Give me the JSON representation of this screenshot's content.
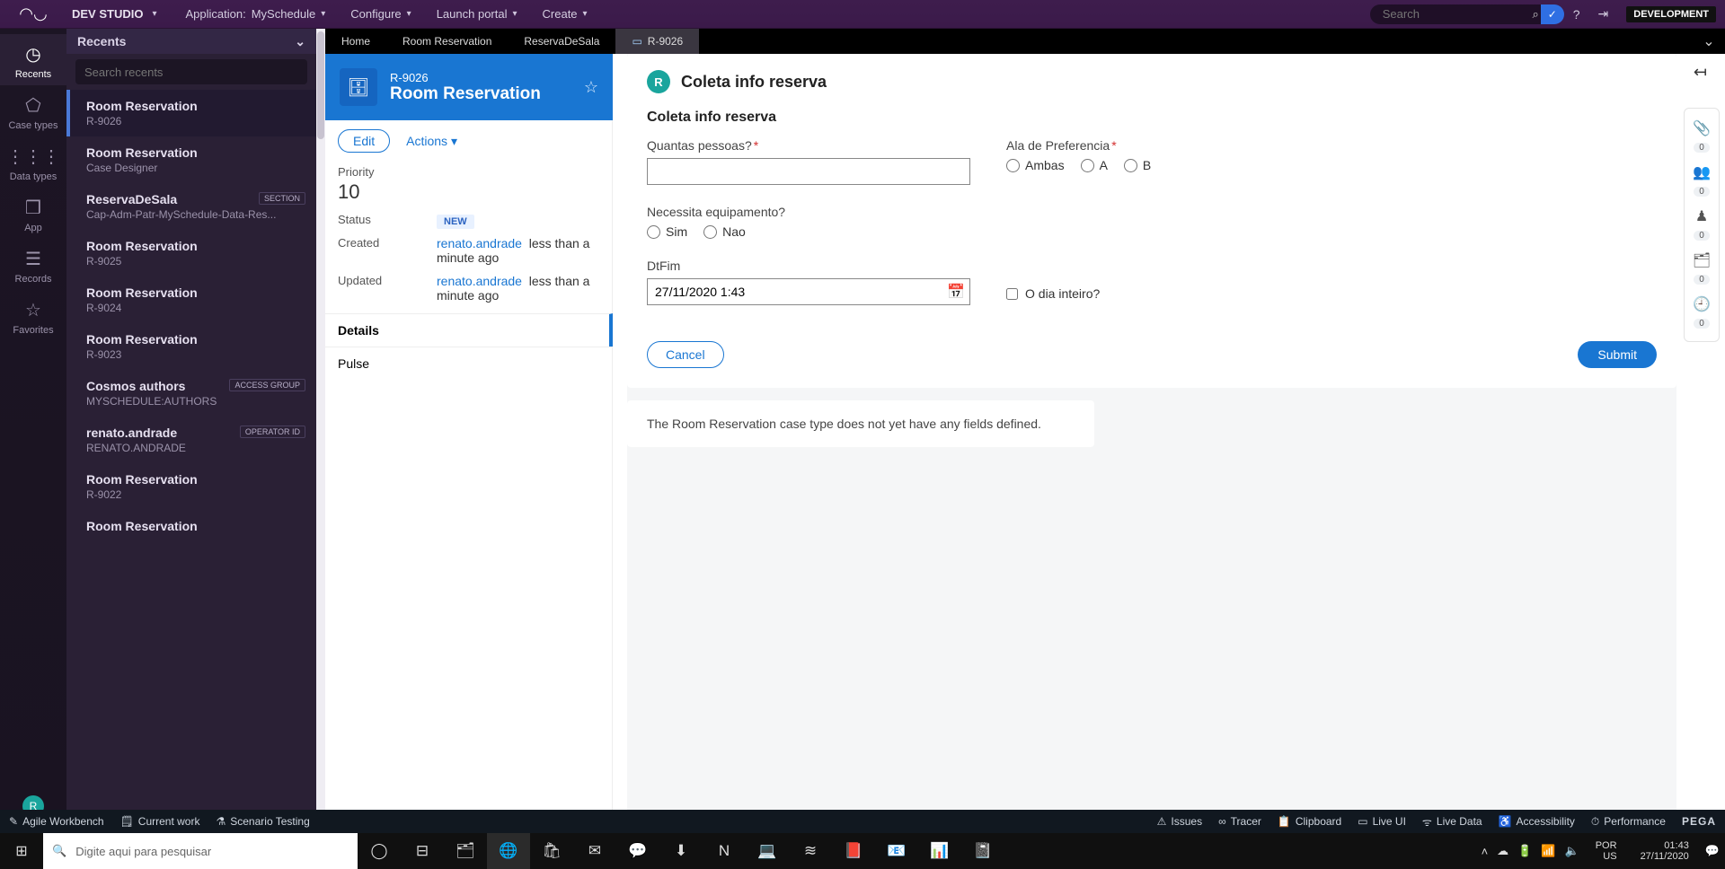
{
  "header": {
    "brand": "DEV STUDIO",
    "app_label": "Application:",
    "app_name": "MySchedule",
    "menu": [
      "Configure",
      "Launch portal",
      "Create"
    ],
    "search_placeholder": "Search",
    "env_badge": "DEVELOPMENT"
  },
  "rail": {
    "items": [
      {
        "label": "Recents",
        "glyph": "◷"
      },
      {
        "label": "Case types",
        "glyph": "⬠"
      },
      {
        "label": "Data types",
        "glyph": "⋮⋮⋮"
      },
      {
        "label": "App",
        "glyph": "❒"
      },
      {
        "label": "Records",
        "glyph": "☰"
      },
      {
        "label": "Favorites",
        "glyph": "☆"
      }
    ],
    "avatar_initial": "R"
  },
  "recents": {
    "title": "Recents",
    "search_placeholder": "Search recents",
    "items": [
      {
        "t": "Room Reservation",
        "s": "R-9026",
        "active": true
      },
      {
        "t": "Room Reservation",
        "s": "Case Designer"
      },
      {
        "t": "ReservaDeSala",
        "s": "Cap-Adm-Patr-MySchedule-Data-Res...",
        "tag": "SECTION"
      },
      {
        "t": "Room Reservation",
        "s": "R-9025"
      },
      {
        "t": "Room Reservation",
        "s": "R-9024"
      },
      {
        "t": "Room Reservation",
        "s": "R-9023"
      },
      {
        "t": "Cosmos authors",
        "s": "MYSCHEDULE:AUTHORS",
        "tag": "ACCESS GROUP"
      },
      {
        "t": "renato.andrade",
        "s": "RENATO.ANDRADE",
        "tag": "OPERATOR ID"
      },
      {
        "t": "Room Reservation",
        "s": "R-9022"
      },
      {
        "t": "Room Reservation",
        "s": ""
      }
    ]
  },
  "tabs": {
    "items": [
      "Home",
      "Room Reservation",
      "ReservaDeSala"
    ],
    "active": {
      "label": "R-9026"
    }
  },
  "case": {
    "id": "R-9026",
    "type": "Room Reservation",
    "edit": "Edit",
    "actions": "Actions",
    "priority_label": "Priority",
    "priority": "10",
    "status_label": "Status",
    "status": "NEW",
    "created_label": "Created",
    "created_user": "renato.andrade",
    "created_when": "less than a minute ago",
    "updated_label": "Updated",
    "updated_user": "renato.andrade",
    "updated_when": "less than a minute ago",
    "nav": {
      "details": "Details",
      "pulse": "Pulse"
    }
  },
  "form": {
    "step_badge": "R",
    "step_title": "Coleta info reserva",
    "section_title": "Coleta info reserva",
    "q_people": "Quantas pessoas?",
    "q_wing": "Ala de Preferencia",
    "wing_opts": [
      "Ambas",
      "A",
      "B"
    ],
    "q_equip": "Necessita equipamento?",
    "equip_opts": [
      "Sim",
      "Nao"
    ],
    "q_dtfim": "DtFim",
    "dtfim_value": "27/11/2020 1:43",
    "q_allday": "O dia inteiro?",
    "cancel": "Cancel",
    "submit": "Submit",
    "info_text": "The Room Reservation case type does not yet have any fields defined."
  },
  "util_counts": [
    "0",
    "0",
    "0",
    "0",
    "0"
  ],
  "devbar": {
    "left": [
      "Agile Workbench",
      "Current work",
      "Scenario Testing"
    ],
    "right": [
      "Issues",
      "Tracer",
      "Clipboard",
      "Live UI",
      "Live Data",
      "Accessibility",
      "Performance"
    ],
    "brand": "PEGA"
  },
  "taskbar": {
    "search_placeholder": "Digite aqui para pesquisar",
    "lang1": "POR",
    "lang2": "US",
    "time": "01:43",
    "date": "27/11/2020"
  }
}
